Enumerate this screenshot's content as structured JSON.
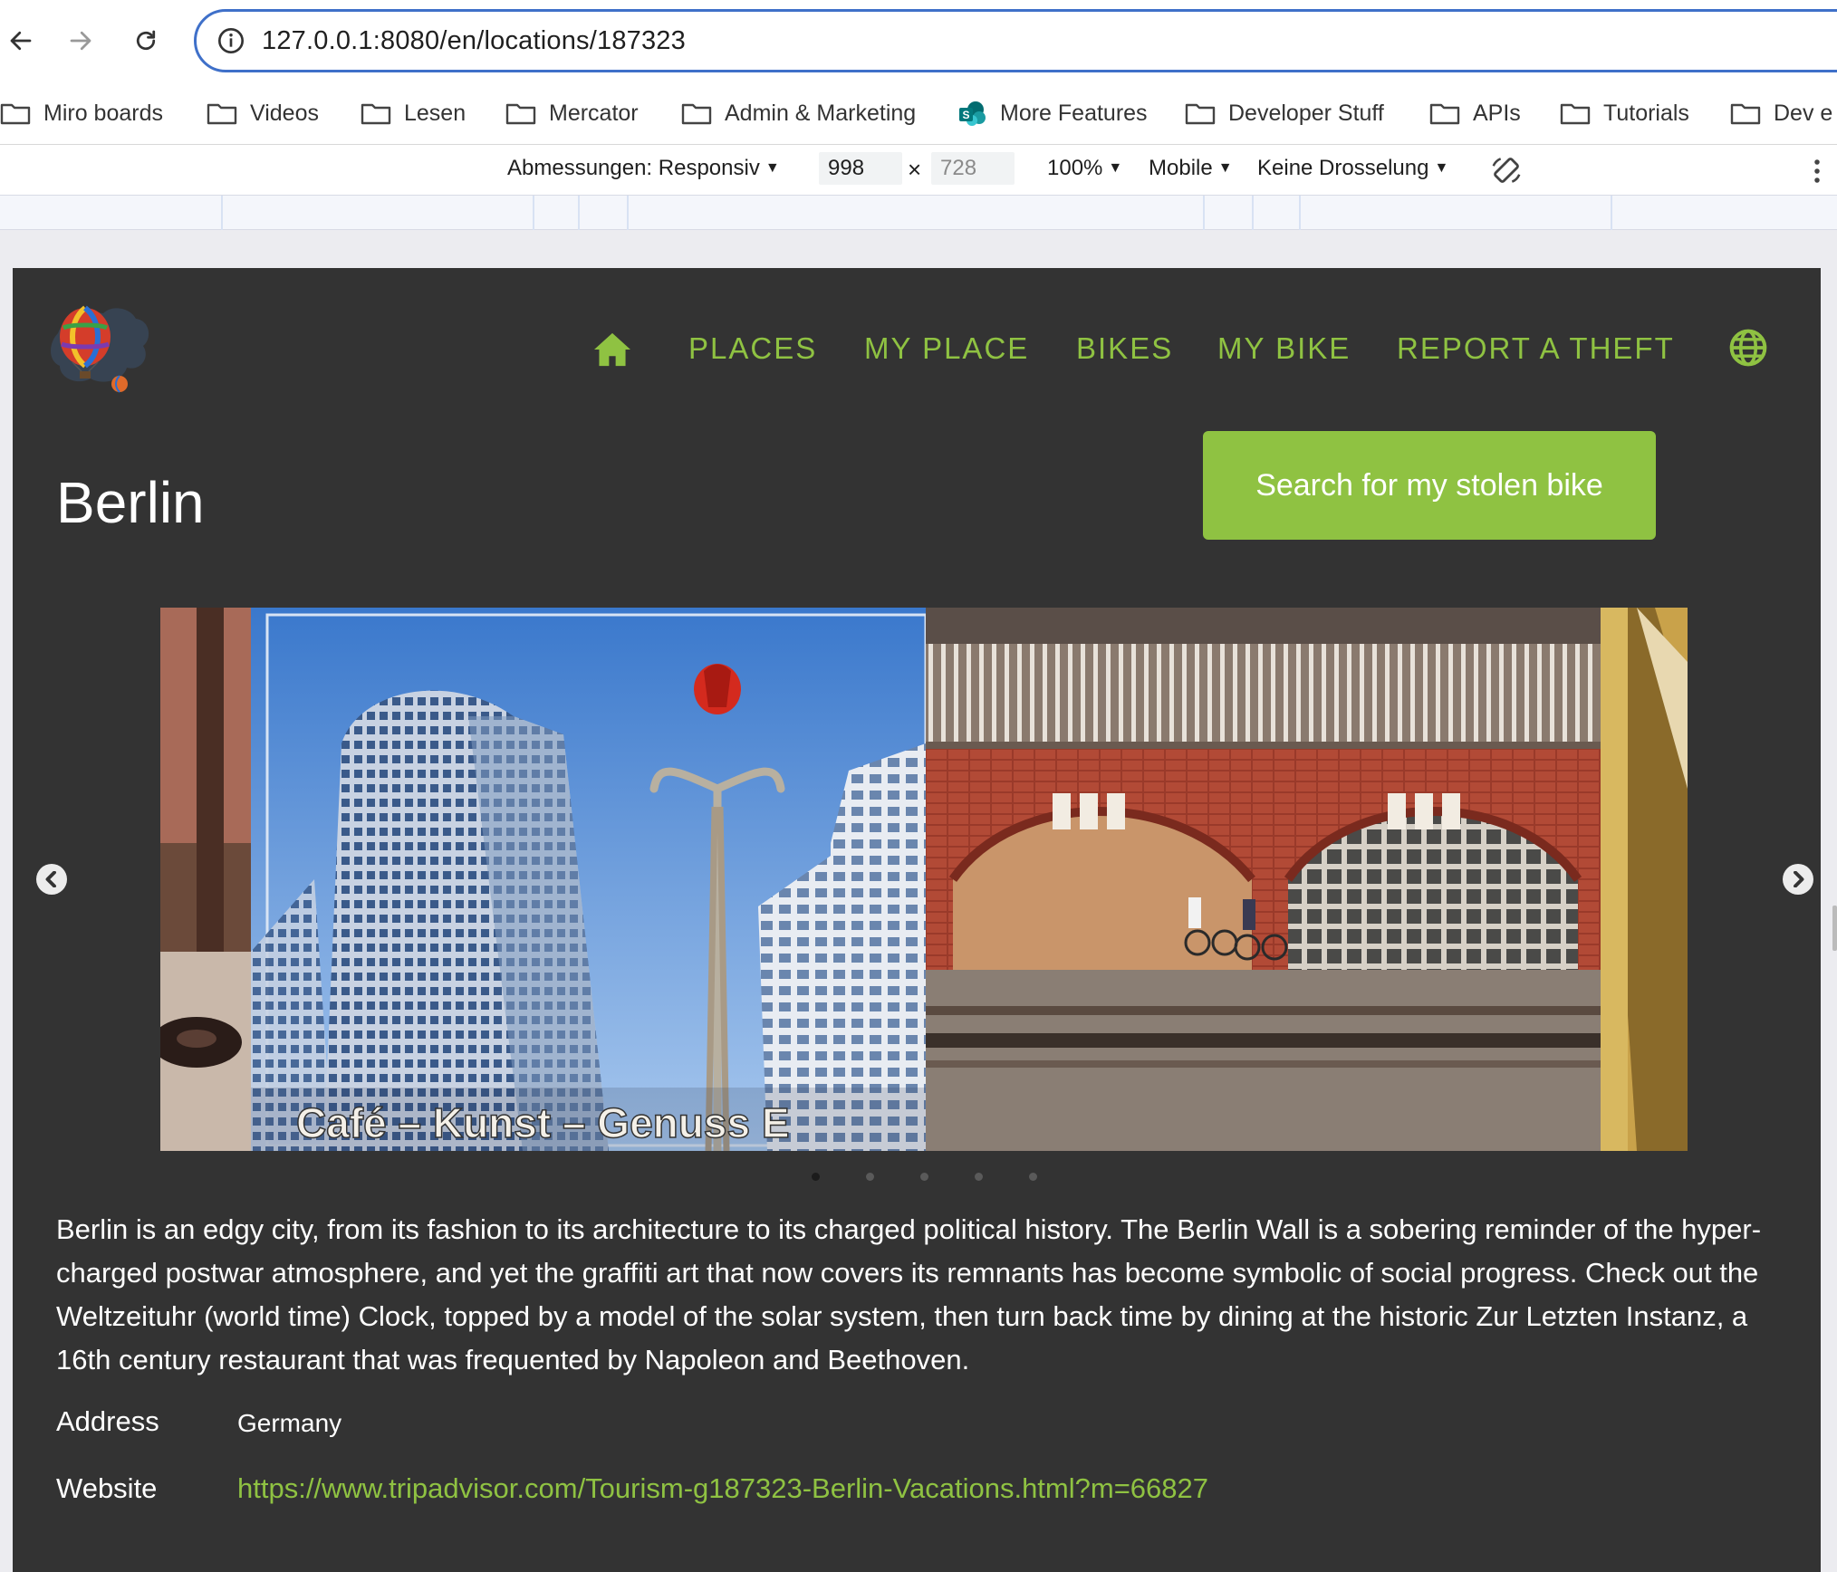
{
  "browser": {
    "url": "127.0.0.1:8080/en/locations/187323",
    "bookmarks": [
      {
        "label": "Miro boards",
        "icon": "folder-icon"
      },
      {
        "label": "Videos",
        "icon": "folder-icon"
      },
      {
        "label": "Lesen",
        "icon": "folder-icon"
      },
      {
        "label": "Mercator",
        "icon": "folder-icon"
      },
      {
        "label": "Admin & Marketing",
        "icon": "folder-icon"
      },
      {
        "label": "More Features",
        "icon": "sharepoint-icon"
      },
      {
        "label": "Developer Stuff",
        "icon": "folder-icon"
      },
      {
        "label": "APIs",
        "icon": "folder-icon"
      },
      {
        "label": "Tutorials",
        "icon": "folder-icon"
      },
      {
        "label": "Dev e",
        "icon": "folder-icon"
      }
    ]
  },
  "devtools": {
    "dimensions_label": "Abmessungen: Responsiv",
    "width": "998",
    "height": "728",
    "times": "×",
    "zoom": "100%",
    "device_type": "Mobile",
    "throttling": "Keine Drosselung"
  },
  "site": {
    "nav": [
      "PLACES",
      "MY PLACE",
      "BIKES",
      "MY BIKE",
      "REPORT A THEFT"
    ],
    "title": "Berlin",
    "cta_label": "Search for my stolen bike",
    "carousel": {
      "slide_caption": "Café – Kunst – Genuss E",
      "slide_count": 5,
      "active_index": 0
    },
    "description": "Berlin is an edgy city, from its fashion to its architecture to its charged political history. The Berlin Wall is a sobering reminder of the hyper-charged postwar atmosphere, and yet the graffiti art that now covers its remnants has become symbolic of social progress. Check out the Weltzeituhr (world time) Clock, topped by a model of the solar system, then turn back time by dining at the historic Zur Letzten Instanz, a 16th century restaurant that was frequented by Napoleon and Beethoven.",
    "address_label": "Address",
    "address_value": "Germany",
    "website_label": "Website",
    "website_value": "https://www.tripadvisor.com/Tourism-g187323-Berlin-Vacations.html?m=66827",
    "accent_color": "#8fc242",
    "background_color": "#333333"
  }
}
